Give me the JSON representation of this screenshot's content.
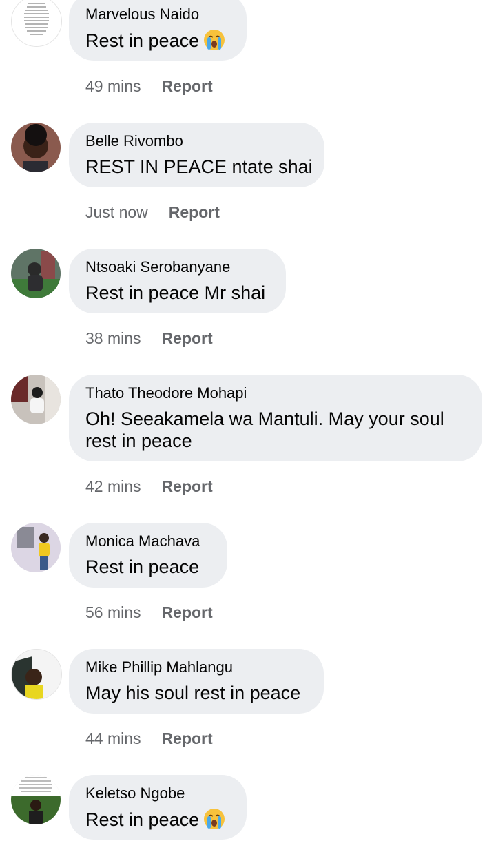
{
  "comments": [
    {
      "name": "Marvelous Naido",
      "text": "Rest in peace",
      "emoji": "crying-face",
      "time": "49 mins",
      "action": "Report",
      "avatar_text": "I'm too old to worry about who likes me and who dislikes me. I have more important things to do. If you love me, I love you. If you support me, I support you. If you hate me, I don't care. Life goes on with or without you."
    },
    {
      "name": "Belle Rivombo",
      "text": "REST IN PEACE ntate shai",
      "time": "Just now",
      "action": "Report"
    },
    {
      "name": "Ntsoaki Serobanyane",
      "text": "Rest in peace Mr shai",
      "time": "38 mins",
      "action": "Report"
    },
    {
      "name": "Thato Theodore Mohapi",
      "text": "Oh! Seeakamela wa Mantuli. May your soul rest in peace",
      "time": "42 mins",
      "action": "Report"
    },
    {
      "name": "Monica Machava",
      "text": "Rest in peace",
      "time": "56 mins",
      "action": "Report"
    },
    {
      "name": "Mike Phillip Mahlangu",
      "text": "May his soul rest in peace",
      "time": "44 mins",
      "action": "Report"
    },
    {
      "name": "Keletso Ngobe",
      "text": "Rest in peace",
      "emoji": "crying-face",
      "time": "",
      "action": ""
    }
  ],
  "colors": {
    "bubble": "#eceef1",
    "meta_text": "#65676b",
    "body_text": "#050505",
    "emoji_face": "#f7c23c",
    "emoji_tears": "#4aa8e8"
  }
}
